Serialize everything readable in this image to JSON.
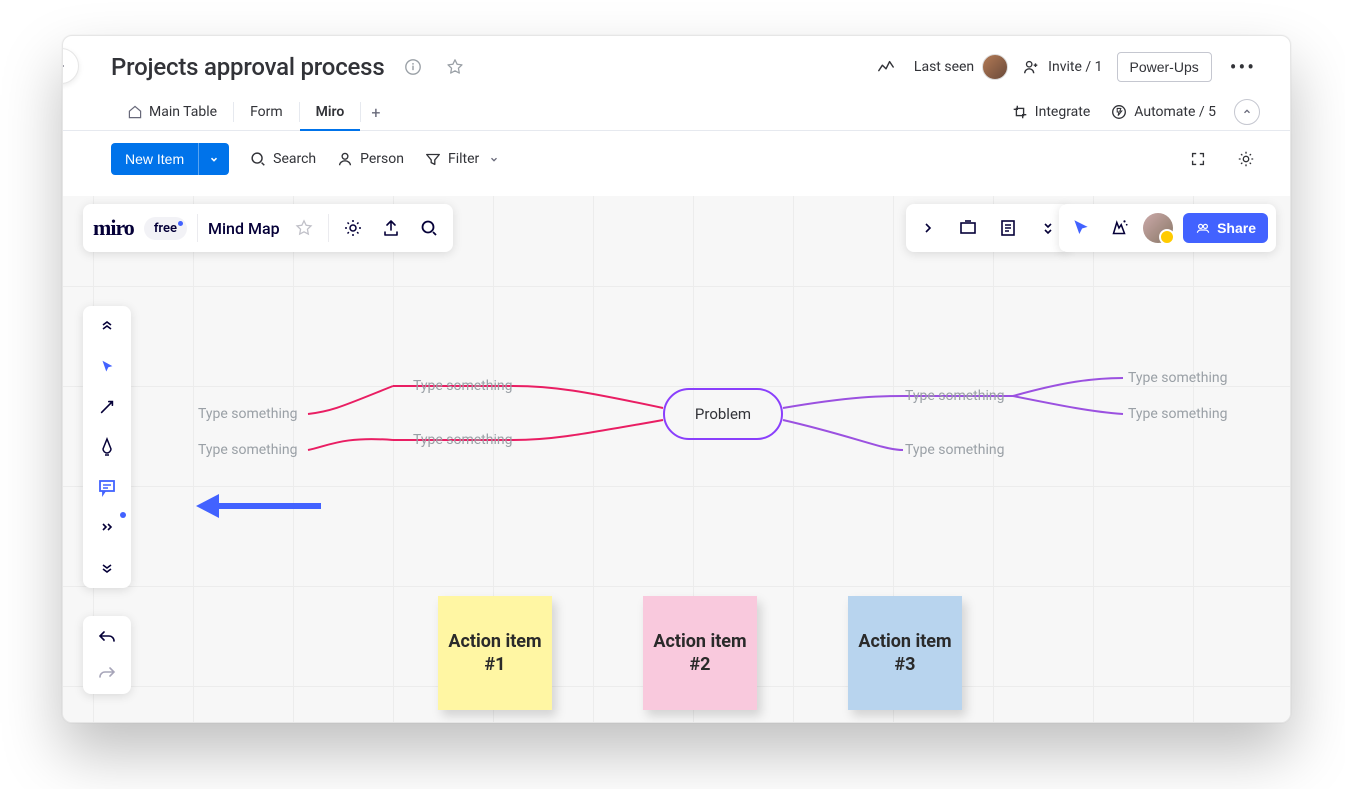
{
  "header": {
    "title": "Projects approval process",
    "last_seen": "Last seen",
    "invite": "Invite / 1",
    "powerups": "Power-Ups"
  },
  "tabs": {
    "main_table": "Main Table",
    "form": "Form",
    "miro": "Miro",
    "integrate": "Integrate",
    "automate": "Automate / 5"
  },
  "toolbar": {
    "new_item": "New Item",
    "search": "Search",
    "person": "Person",
    "filter": "Filter"
  },
  "miro": {
    "logo": "miro",
    "plan": "free",
    "board_name": "Mind Map",
    "share": "Share"
  },
  "mindmap": {
    "center": "Problem",
    "left_top": "Type something",
    "left_bottom": "Type something",
    "left_merge_top": "Type something",
    "left_merge_bottom": "Type something",
    "right_top": "Type something",
    "right_bottom": "Type something",
    "far_right_top": "Type something",
    "far_right_bottom": "Type something"
  },
  "stickies": {
    "one": "Action item #1",
    "two": "Action item #2",
    "three": "Action item #3"
  }
}
